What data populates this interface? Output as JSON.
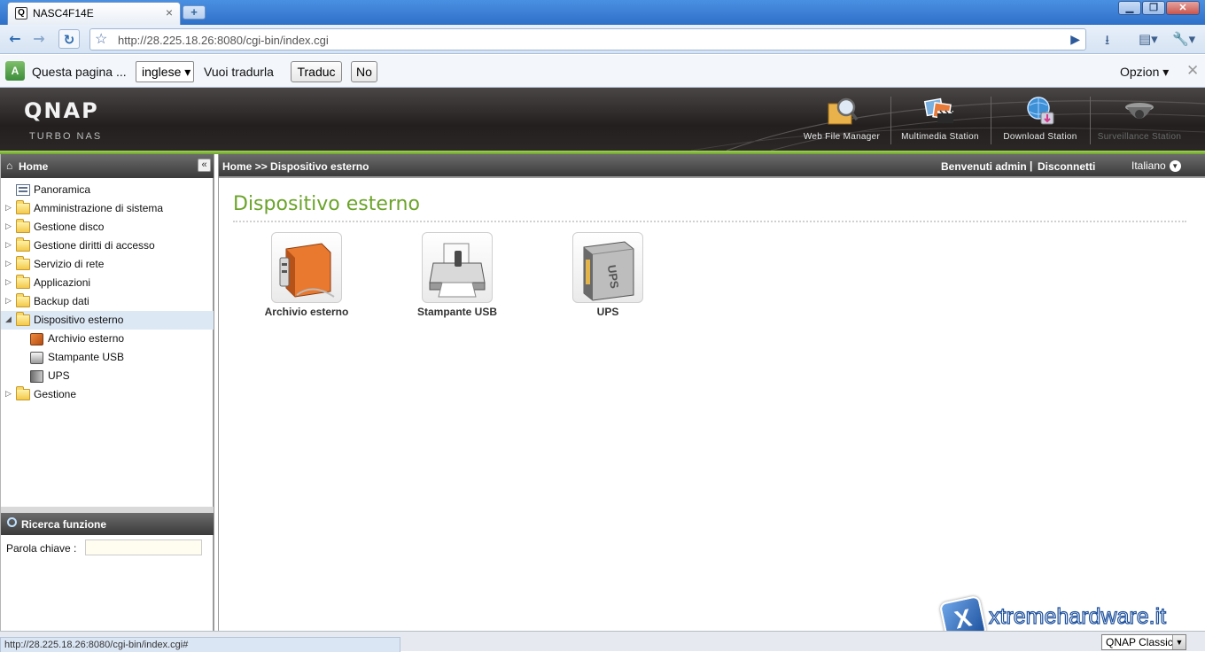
{
  "browser": {
    "tab_title": "NASC4F14E",
    "tab_close": "×",
    "new_tab": "+",
    "window_controls": {
      "minimize": "▁",
      "maximize": "❐",
      "close": "✕"
    },
    "url": "http://28.225.18.26:8080/cgi-bin/index.cgi",
    "nav_back": "←",
    "nav_forward": "→",
    "nav_reload": "↻",
    "bookmark_icon": "☆",
    "go_icon": "▶",
    "toolbar_icons": [
      "download-icon",
      "page-menu-icon",
      "wrench-icon"
    ],
    "toolbar_glyphs": {
      "download": "⭳",
      "page": "▤▾",
      "wrench": "🔧▾"
    }
  },
  "infobar": {
    "message": "Questa pagina ...",
    "language": "inglese ▾",
    "question": "Vuoi tradurla",
    "translate_button": "Traduc",
    "no_button": "No",
    "options": "Opzion ▾",
    "close": "✕",
    "translate_icon_text": "A"
  },
  "header": {
    "logo": "QNAP",
    "subtitle": "TURBO NAS",
    "apps": [
      {
        "label": "Web File Manager",
        "icon": "magnifier-folder-icon"
      },
      {
        "label": "Multimedia Station",
        "icon": "clapper-photos-icon"
      },
      {
        "label": "Download Station",
        "icon": "globe-download-icon"
      },
      {
        "label": "Surveillance Station",
        "icon": "dome-camera-icon"
      }
    ],
    "accent_green": "#6ba32a"
  },
  "sidebar": {
    "home_label": "Home",
    "home_icon": "⌂",
    "collapse": "«",
    "items": [
      {
        "label": "Panoramica",
        "icon": "page-icon",
        "expandable": false
      },
      {
        "label": "Amministrazione di sistema",
        "icon": "folder-icon",
        "expandable": true
      },
      {
        "label": "Gestione disco",
        "icon": "folder-icon",
        "expandable": true
      },
      {
        "label": "Gestione diritti di accesso",
        "icon": "folder-icon",
        "expandable": true
      },
      {
        "label": "Servizio di rete",
        "icon": "folder-icon",
        "expandable": true
      },
      {
        "label": "Applicazioni",
        "icon": "folder-icon",
        "expandable": true
      },
      {
        "label": "Backup dati",
        "icon": "folder-icon",
        "expandable": true
      },
      {
        "label": "Dispositivo esterno",
        "icon": "folder-icon",
        "expandable": true,
        "expanded": true,
        "selected": true
      },
      {
        "label": "Archivio esterno",
        "icon": "external-disk-icon",
        "sub": true
      },
      {
        "label": "Stampante USB",
        "icon": "printer-icon",
        "sub": true
      },
      {
        "label": "UPS",
        "icon": "ups-icon",
        "sub": true
      },
      {
        "label": "Gestione",
        "icon": "folder-icon",
        "expandable": true
      }
    ],
    "arrow_collapsed": "▷",
    "arrow_expanded": "◢",
    "search": {
      "title": "Ricerca funzione",
      "keyword_label": "Parola chiave :",
      "keyword_value": ""
    }
  },
  "main": {
    "breadcrumb_home": "Home",
    "breadcrumb_sep": ">>",
    "breadcrumb_current": "Dispositivo esterno",
    "welcome": "Benvenuti admin",
    "separator": "|",
    "logout": "Disconnetti",
    "language": "Italiano",
    "language_arrow": "▼",
    "page_title": "Dispositivo esterno",
    "tiles": [
      {
        "label": "Archivio esterno",
        "icon": "external-disk-icon"
      },
      {
        "label": "Stampante USB",
        "icon": "printer-icon"
      },
      {
        "label": "UPS",
        "icon": "ups-icon"
      }
    ]
  },
  "statusbar": {
    "url": "http://28.225.18.26:8080/cgi-bin/index.cgi#",
    "skin": "QNAP Classic",
    "skin_arrow": "▼",
    "watermark": "xtremehardware.it",
    "watermark_badge": "X"
  }
}
